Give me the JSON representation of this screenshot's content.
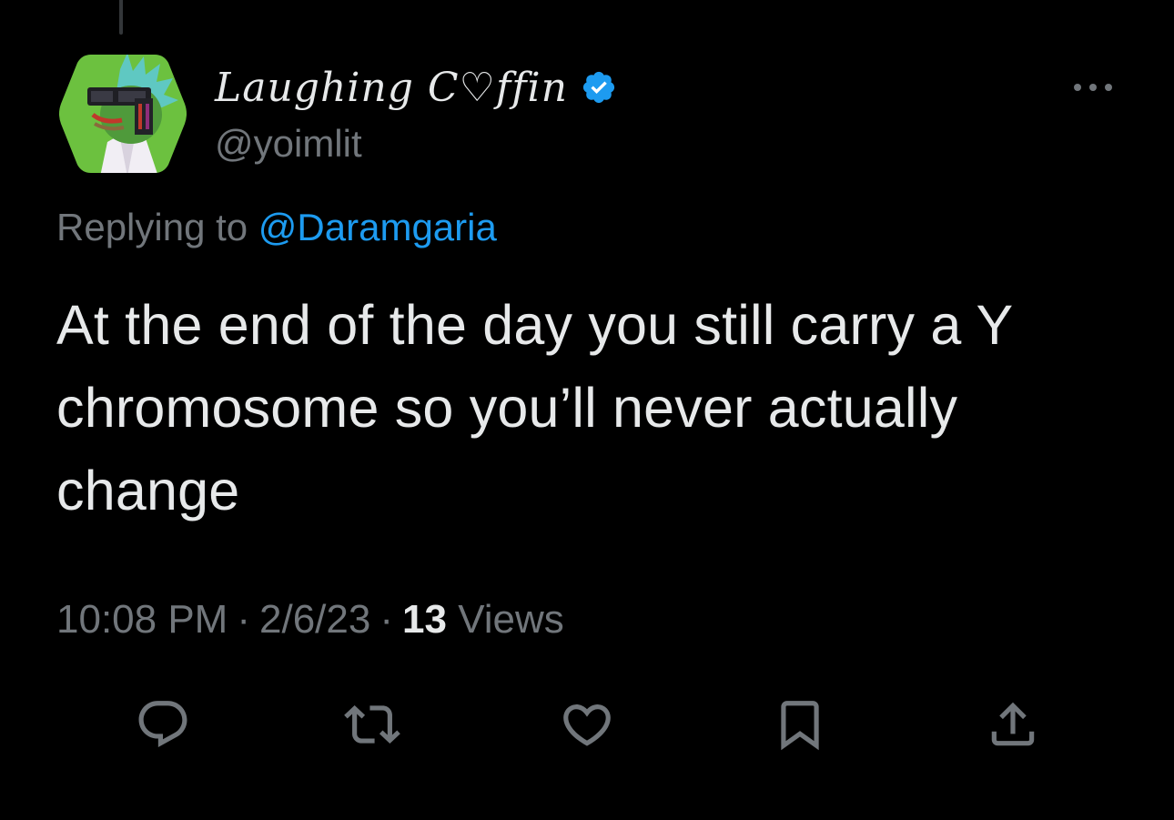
{
  "tweet": {
    "display_name": "Laughing C♡ffin",
    "handle": "@yoimlit",
    "replying_to_prefix": "Replying to",
    "replying_to_handle": "@Daramgaria",
    "text": "At the end of the day you still carry a Y chromosome so you’ll never actually change",
    "time": "10:08 PM",
    "separator": "·",
    "date": "2/6/23",
    "views_count": "13",
    "views_label": "Views"
  },
  "icons": {
    "verified": "verified-badge-icon",
    "more": "more-dots-icon",
    "reply": "reply-icon",
    "retweet": "retweet-icon",
    "like": "like-icon",
    "bookmark": "bookmark-icon",
    "share": "share-icon"
  },
  "colors": {
    "background": "#000000",
    "primary_text": "#e7e9ea",
    "secondary_text": "#71767b",
    "link": "#1d9bf0",
    "verified": "#1d9bf0",
    "avatar_bg": "#6cc13f"
  }
}
